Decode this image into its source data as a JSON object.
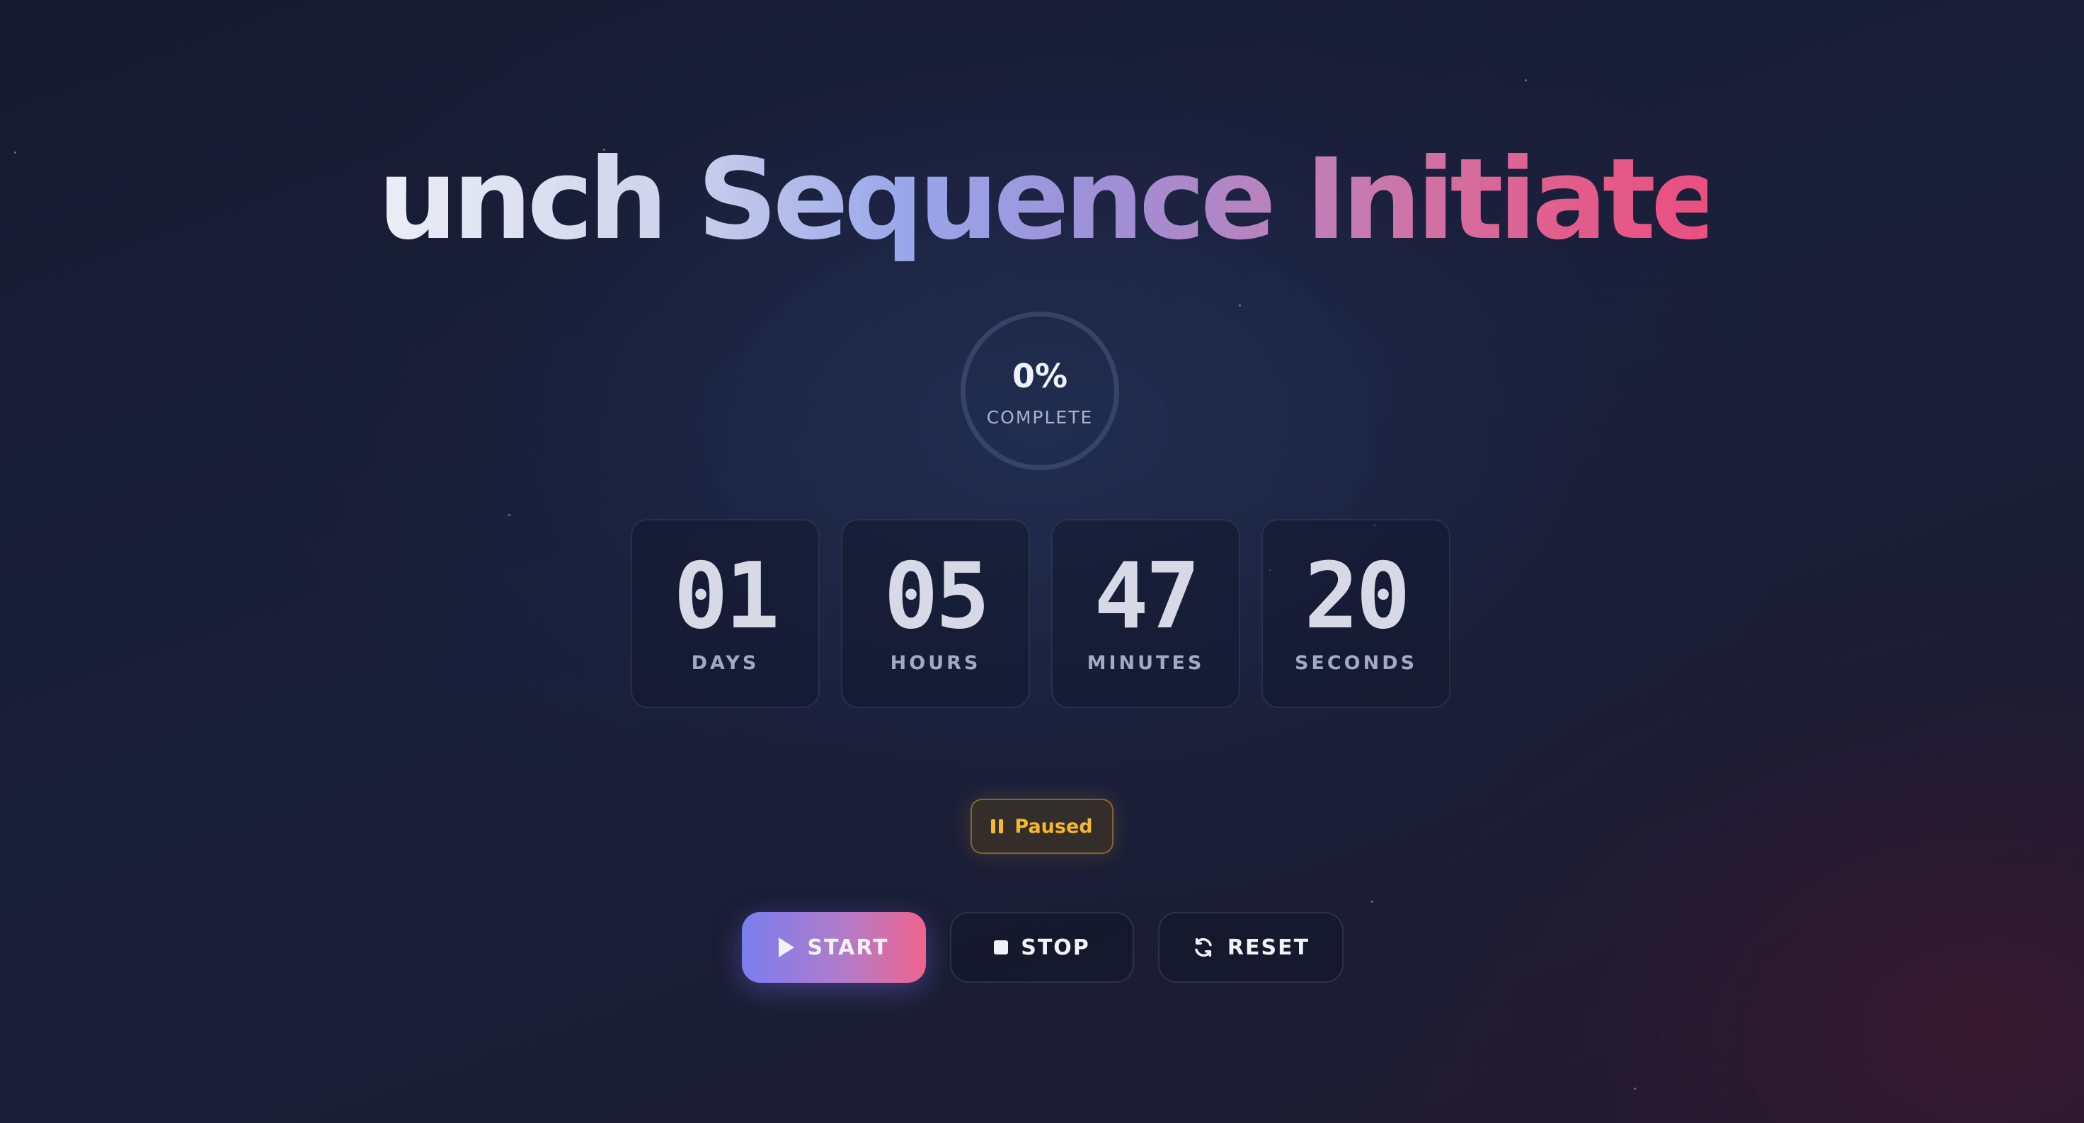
{
  "title": "Launch Sequence Initiated!",
  "progress": {
    "value_text": "0%",
    "value": 0,
    "label": "COMPLETE"
  },
  "countdown": [
    {
      "value": "01",
      "label": "DAYS"
    },
    {
      "value": "05",
      "label": "HOURS"
    },
    {
      "value": "47",
      "label": "MINUTES"
    },
    {
      "value": "20",
      "label": "SECONDS"
    }
  ],
  "status": {
    "text": "Paused",
    "icon": "pause-icon",
    "color": "#f5b82e"
  },
  "controls": {
    "start_label": "START",
    "stop_label": "STOP",
    "reset_label": "RESET"
  },
  "colors": {
    "accent_start": "#7a7ef0",
    "accent_end": "#f0648f",
    "background": "#1a1f3a"
  }
}
